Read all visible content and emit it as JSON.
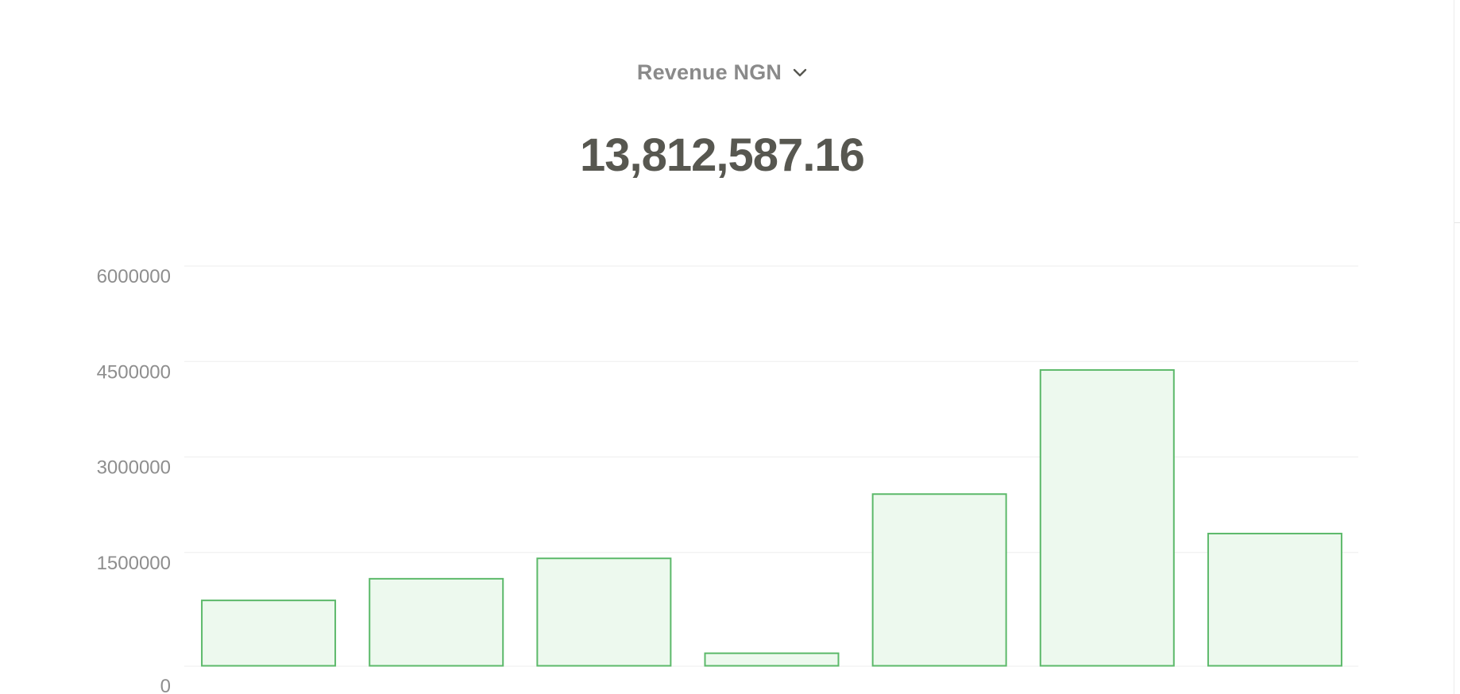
{
  "metric": {
    "selector_label": "Revenue NGN",
    "selector_icon": "chevron-down-icon",
    "total_value": "13,812,587.16"
  },
  "colors": {
    "bar_fill": "#edf9ee",
    "bar_stroke": "#5cb96a",
    "grid": "#eeeeee",
    "tick_text": "#8e8e8e",
    "value_text": "#575750"
  },
  "chart_data": {
    "type": "bar",
    "categories": [
      "",
      "",
      "",
      "",
      "",
      "",
      ""
    ],
    "values": [
      1040000,
      1380000,
      1700000,
      210000,
      2710000,
      4660000,
      2090000
    ],
    "y_ticks": [
      "0",
      "1500000",
      "3000000",
      "4500000",
      "6000000"
    ],
    "ylim": [
      0,
      6000000
    ],
    "grid": true,
    "legend": "none"
  }
}
